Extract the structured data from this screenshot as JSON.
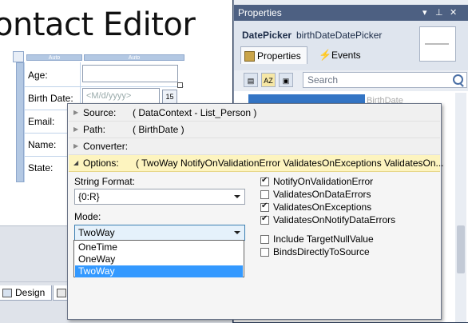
{
  "designer": {
    "title": "ontact Editor",
    "col_header": "Auto",
    "row_header": "Auto",
    "fields": [
      "Age:",
      "Birth Date:",
      "Email:",
      "Name:",
      "State:"
    ],
    "date_placeholder": "<M/d/yyyy>",
    "calendar_day": "15",
    "tabs": [
      "Design",
      ""
    ]
  },
  "properties": {
    "panel_title": "Properties",
    "control_type": "DatePicker",
    "control_name": "birthDateDatePicker",
    "tabs": {
      "properties": "Properties",
      "events": "Events"
    },
    "search_placeholder": "Search",
    "grid_value": "BirthDate"
  },
  "binding": {
    "rows": [
      {
        "key": "Source:",
        "value": "( DataContext - List_Person )"
      },
      {
        "key": "Path:",
        "value": "( BirthDate )"
      },
      {
        "key": "Converter:",
        "value": ""
      },
      {
        "key": "Options:",
        "value": "( TwoWay NotifyOnValidationError ValidatesOnExceptions ValidatesOn..."
      }
    ],
    "string_format_label": "String Format:",
    "string_format_value": "{0:R}",
    "mode_label": "Mode:",
    "mode_value": "TwoWay",
    "mode_options": [
      "OneTime",
      "OneWay",
      "TwoWay"
    ],
    "mode_selected": "TwoWay",
    "checkboxes": [
      {
        "label": "NotifyOnValidationError",
        "checked": true
      },
      {
        "label": "ValidatesOnDataErrors",
        "checked": false
      },
      {
        "label": "ValidatesOnExceptions",
        "checked": true
      },
      {
        "label": "ValidatesOnNotifyDataErrors",
        "checked": true
      }
    ],
    "extra_checkboxes": [
      {
        "label": "Include TargetNullValue",
        "checked": false
      },
      {
        "label": "BindsDirectlyToSource",
        "checked": false
      }
    ]
  },
  "colors": {
    "titlebar": "#4d6082",
    "options_highlight": "#fdf4bf",
    "selection": "#3399ff",
    "grid_selection": "#3374c4"
  }
}
